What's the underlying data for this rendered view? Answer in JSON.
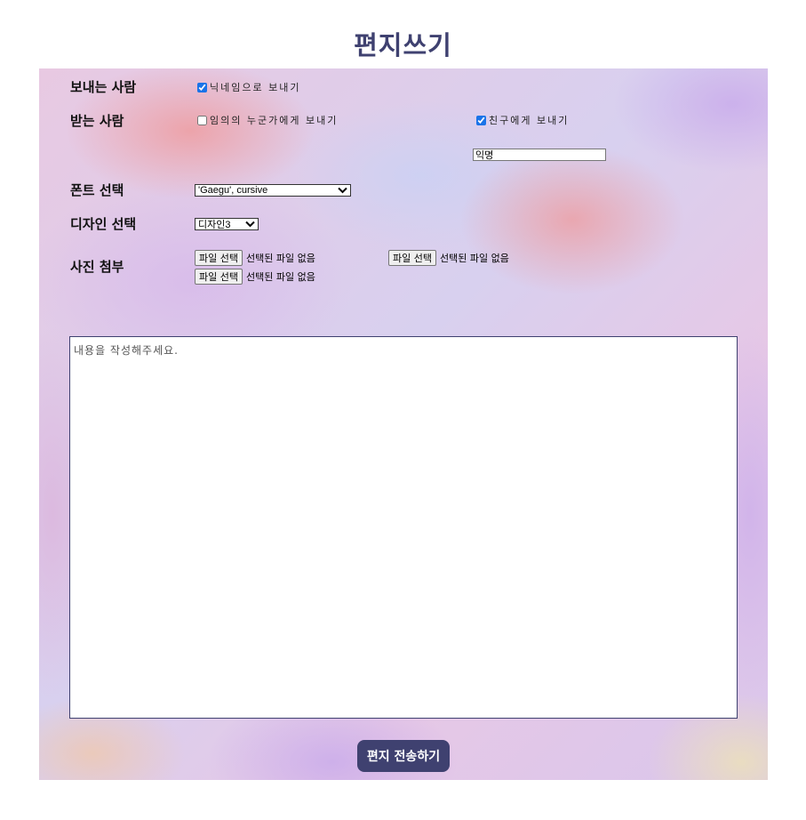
{
  "page": {
    "title": "편지쓰기"
  },
  "sender": {
    "label": "보내는 사람",
    "nickname_option": {
      "label": "닉네임으로 보내기",
      "checked": true
    }
  },
  "recipient": {
    "label": "받는 사람",
    "random_option": {
      "label": "임의의 누군가에게 보내기",
      "checked": false
    },
    "friend_option": {
      "label": "친구에게 보내기",
      "checked": true
    },
    "nickname_value": "익명"
  },
  "font_select": {
    "label": "폰트 선택",
    "value": "'Gaegu', cursive"
  },
  "design_select": {
    "label": "디자인 선택",
    "value": "디자인3"
  },
  "photo": {
    "label": "사진 첨부",
    "files": [
      {
        "button": "파일 선택",
        "status": "선택된 파일 없음"
      },
      {
        "button": "파일 선택",
        "status": "선택된 파일 없음"
      },
      {
        "button": "파일 선택",
        "status": "선택된 파일 없음"
      }
    ]
  },
  "content": {
    "placeholder": "내용을 작성해주세요."
  },
  "submit": {
    "label": "편지 전송하기"
  },
  "colors": {
    "accent": "#3f4170",
    "checkbox": "#1a73e8"
  }
}
